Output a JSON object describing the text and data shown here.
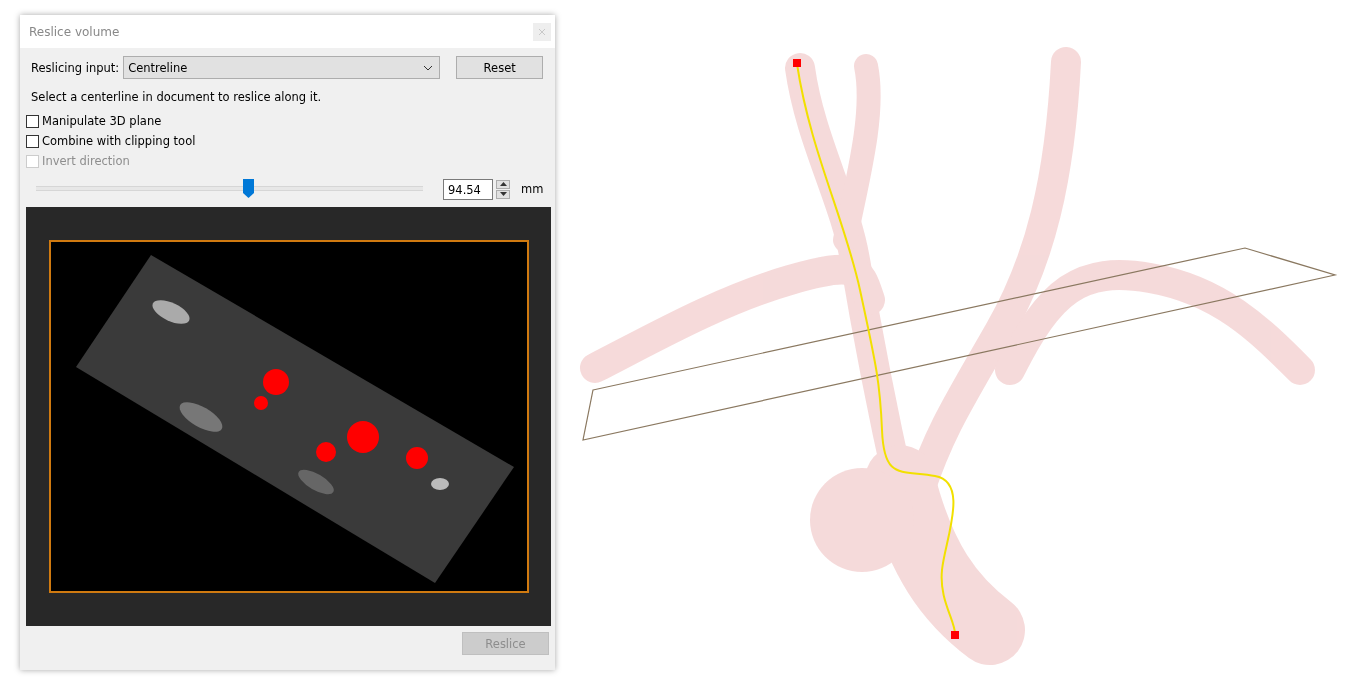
{
  "window": {
    "title": "Reslice volume"
  },
  "reslicing_input": {
    "label": "Reslicing input:",
    "value": "Centreline"
  },
  "reset_button": {
    "label": "Reset"
  },
  "hint": "Select a centerline in document to reslice along it.",
  "checkboxes": [
    {
      "label": "Manipulate 3D plane",
      "checked": false,
      "disabled": false
    },
    {
      "label": "Combine with clipping tool",
      "checked": false,
      "disabled": false
    },
    {
      "label": "Invert direction",
      "checked": false,
      "disabled": true
    }
  ],
  "slider": {
    "level": 0.54
  },
  "position_field": {
    "value": "94.54",
    "unit": "mm"
  },
  "reslice_button": {
    "label": "Reslice",
    "disabled": true
  }
}
